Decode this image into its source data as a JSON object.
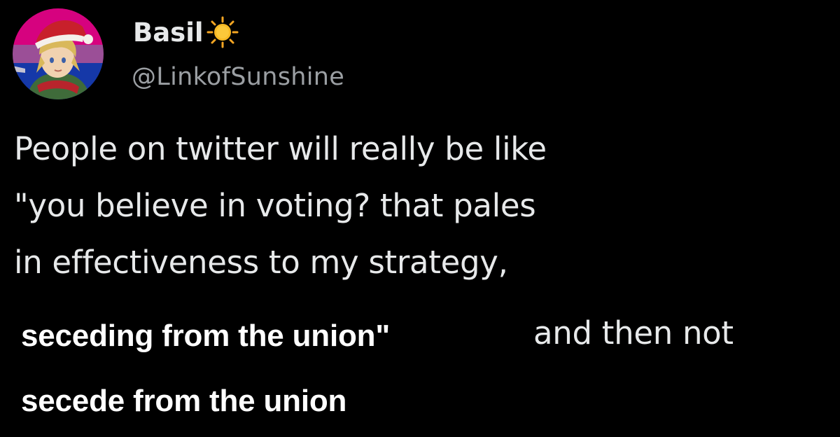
{
  "author": {
    "display_name": "Basil",
    "name_emoji_icon": "sun-emoji-icon",
    "handle": "@LinkofSunshine",
    "avatar": "profile-avatar"
  },
  "tweet": {
    "lines": [
      "People on twitter will really be like",
      "\"you believe in voting? that pales",
      "in effectiveness to my strategy,"
    ],
    "caption_line_1": "seceding from the union\"",
    "tail_text": "and then not",
    "caption_line_2": "secede from the union"
  },
  "colors": {
    "background": "#000000",
    "primary_text": "#e7e9ea",
    "secondary_text": "#9b9fa3",
    "caption_text": "#ffffff"
  }
}
